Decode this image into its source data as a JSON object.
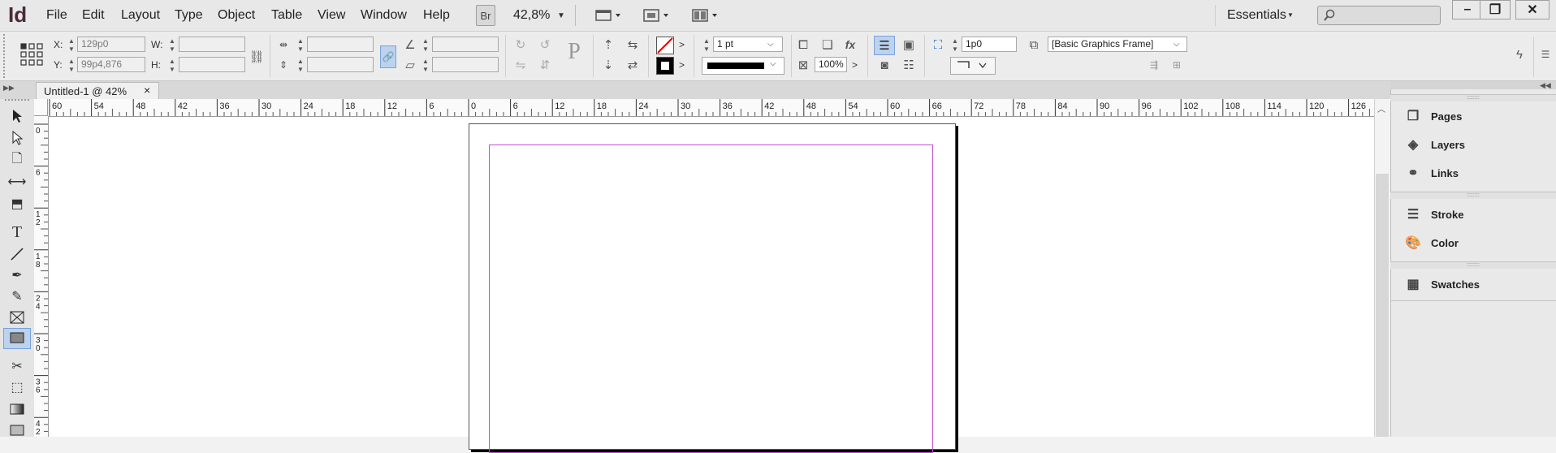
{
  "app": {
    "logo": "Id"
  },
  "menu": [
    "File",
    "Edit",
    "Layout",
    "Type",
    "Object",
    "Table",
    "View",
    "Window",
    "Help"
  ],
  "menubar": {
    "bridge_label": "Br",
    "zoom": "42,8%",
    "workspace": "Essentials"
  },
  "controls": {
    "x_label": "X:",
    "x_value": "129p0",
    "y_label": "Y:",
    "y_value": "99p4,876",
    "w_label": "W:",
    "h_label": "H:",
    "stroke_weight": "1 pt",
    "opacity": "100%",
    "fitting_value": "1p0",
    "object_style": "[Basic Graphics Frame]",
    "text_p": "P"
  },
  "document_tab": {
    "title": "Untitled-1 @ 42%",
    "close": "×"
  },
  "ruler": {
    "h_labels": [
      "60",
      "54",
      "48",
      "42",
      "36",
      "30",
      "24",
      "18",
      "12",
      "6",
      "0",
      "6",
      "12",
      "18",
      "24",
      "30",
      "36",
      "42",
      "48",
      "54",
      "60",
      "66",
      "72",
      "78",
      "84",
      "90",
      "96",
      "102",
      "108",
      "114",
      "120",
      "126"
    ],
    "v_labels": [
      "0",
      "6",
      "12",
      "18",
      "24",
      "30",
      "36",
      "42"
    ]
  },
  "panels": [
    {
      "label": "Pages",
      "icon": "pages-icon"
    },
    {
      "label": "Layers",
      "icon": "layers-icon"
    },
    {
      "label": "Links",
      "icon": "links-icon"
    },
    {
      "label": "Stroke",
      "icon": "stroke-icon"
    },
    {
      "label": "Color",
      "icon": "color-icon"
    },
    {
      "label": "Swatches",
      "icon": "swatches-icon"
    }
  ],
  "colors": {
    "margin_guide": "#c050d0",
    "logo": "#4a2a3a"
  }
}
